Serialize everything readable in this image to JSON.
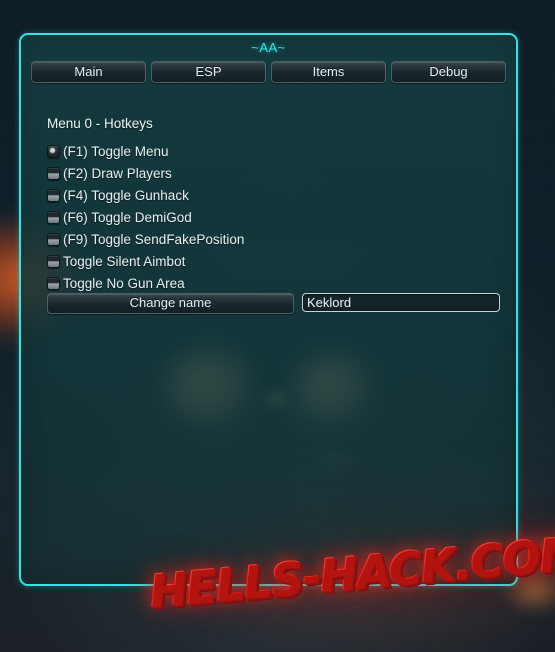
{
  "window": {
    "title": "~AA~"
  },
  "tabs": [
    {
      "label": "Main"
    },
    {
      "label": "ESP"
    },
    {
      "label": "Items"
    },
    {
      "label": "Debug"
    }
  ],
  "main": {
    "section_label": "Menu 0 - Hotkeys",
    "hotkeys": [
      {
        "label": "(F1) Toggle Menu",
        "checked": true
      },
      {
        "label": "(F2) Draw Players",
        "checked": false
      },
      {
        "label": "(F4) Toggle Gunhack",
        "checked": false
      },
      {
        "label": "(F6) Toggle DemiGod",
        "checked": false
      },
      {
        "label": "(F9) Toggle SendFakePosition",
        "checked": false
      },
      {
        "label": "Toggle Silent Aimbot",
        "checked": false
      },
      {
        "label": "Toggle No Gun Area",
        "checked": false
      }
    ],
    "change_name_button": "Change name",
    "name_input_value": "Keklord",
    "name_input_placeholder": ""
  },
  "watermark": {
    "text": "HELLS-HACK.COM"
  },
  "colors": {
    "accent_cyan": "#2fe6e6",
    "panel_fill": "#143f42",
    "button_face": "#2b393e",
    "text_primary": "#eaf0f1",
    "watermark_red": "#f02a22"
  }
}
